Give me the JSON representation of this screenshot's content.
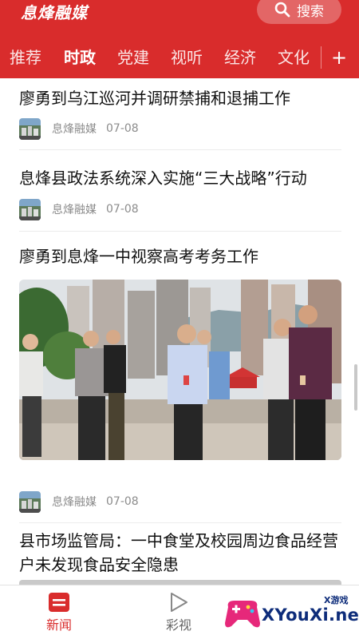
{
  "header": {
    "brand": "息烽融媒",
    "search_label": "搜索",
    "tabs": [
      {
        "label": "推荐"
      },
      {
        "label": "时政"
      },
      {
        "label": "党建"
      },
      {
        "label": "视听"
      },
      {
        "label": "经济"
      },
      {
        "label": "文化"
      }
    ],
    "active_tab": "时政",
    "plus_label": "+"
  },
  "feed": {
    "items": [
      {
        "title": "廖勇到乌江巡河并调研禁捕和退捕工作",
        "source": "息烽融媒",
        "date": "07-08"
      },
      {
        "title": "息烽县政法系统深入实施“三大战略”行动",
        "source": "息烽融媒",
        "date": "07-08"
      },
      {
        "title": "廖勇到息烽一中视察高考考务工作",
        "source": "息烽融媒",
        "date": "07-08"
      },
      {
        "title": "县市场监管局：一中食堂及校园周边食品经营户未发现食品安全隐患"
      }
    ]
  },
  "bottom_nav": {
    "items": [
      {
        "label": "新闻",
        "icon": "news-icon",
        "active": true
      },
      {
        "label": "彩视",
        "icon": "play-icon",
        "active": false
      }
    ]
  },
  "watermark": {
    "text": "XYouXi.net",
    "tag": "X游戏"
  },
  "colors": {
    "brand_red": "#d92c2c",
    "text": "#111111",
    "meta": "#8c8c8c"
  }
}
